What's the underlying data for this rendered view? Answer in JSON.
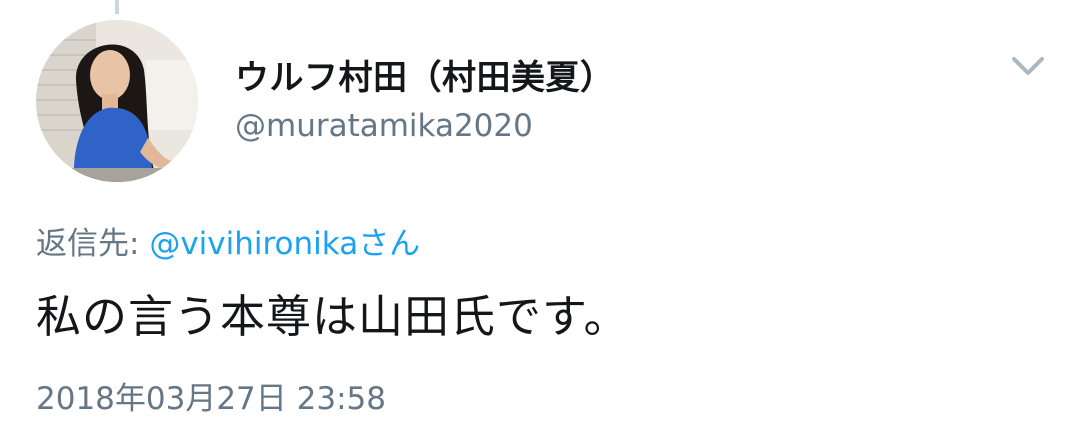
{
  "author": {
    "display_name": "ウルフ村田（村田美夏）",
    "handle": "@muratamika2020",
    "avatar_icon": "profile-photo"
  },
  "menu": {
    "icon": "chevron-down-icon"
  },
  "reply": {
    "prefix": "返信先: ",
    "mention": "@vivihironika",
    "suffix": "さん"
  },
  "tweet": {
    "text": "私の言う本尊は山田氏です。",
    "timestamp": "2018年03月27日 23:58"
  },
  "colors": {
    "text_primary": "#14171a",
    "text_secondary": "#657786",
    "link": "#1da1f2",
    "thread_line": "#ccd6dd"
  }
}
